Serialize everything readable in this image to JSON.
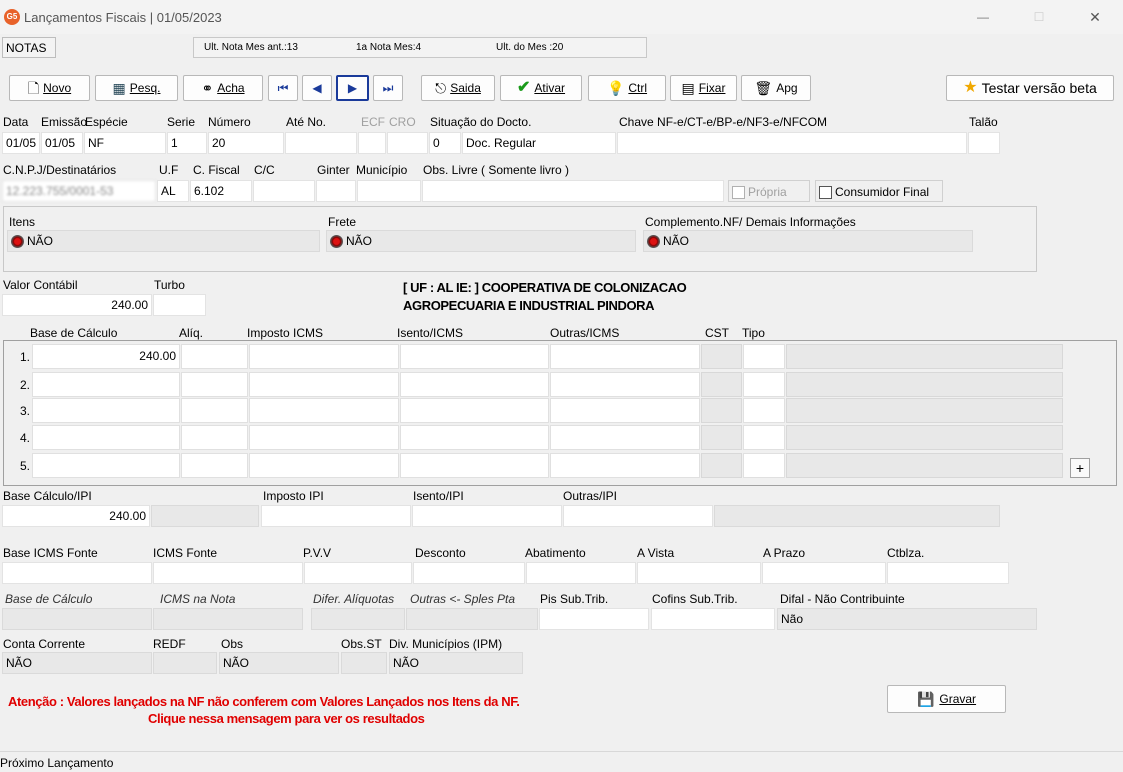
{
  "window": {
    "title": "Lançamentos Fiscais | 01/05/2023",
    "app_icon_text": "G5",
    "min_glyph": "—",
    "max_glyph": "☐",
    "close_glyph": "✕"
  },
  "info_bar": {
    "tab_label": "NOTAS",
    "ult_nota_mes_ant": "Ult. Nota Mes ant.:13",
    "primeira_nota_mes": "1a Nota Mes:4",
    "ult_do_mes": "Ult. do Mes :20"
  },
  "toolbar": {
    "novo": "Novo",
    "pesq": "Pesq.",
    "acha": "Acha",
    "first_glyph": "⏮",
    "prev_glyph": "◀",
    "next_glyph": "▶",
    "last_glyph": "⏭",
    "saida": "Saida",
    "ativar": "Ativar",
    "ctrl": "Ctrl",
    "fixar": "Fixar",
    "apg": "Apg",
    "testar": "Testar versão beta"
  },
  "row1": {
    "labels": {
      "data": "Data",
      "emissao": "Emissão",
      "especie": "Espécie",
      "serie": "Serie",
      "numero": "Número",
      "ate_no": "Até No.",
      "ecf": "ECF",
      "cro": "CRO",
      "situacao": "Situação do Docto.",
      "chave": "Chave NF-e/CT-e/BP-e/NF3-e/NFCOM",
      "talao": "Talão"
    },
    "values": {
      "data": "01/05",
      "emissao": "01/05",
      "especie": "NF",
      "serie": "1",
      "numero": "20",
      "situacao_code": "0",
      "situacao_text": "Doc. Regular"
    }
  },
  "row2": {
    "labels": {
      "cnpj": "C.N.P.J/Destinatários",
      "uf": "U.F",
      "cfiscal": "C. Fiscal",
      "cc": "C/C",
      "ginter": "Ginter",
      "municipio": "Município",
      "obs_livre": "Obs. Livre ( Somente livro )"
    },
    "values": {
      "cnpj": "12.223.755/0001-53",
      "uf": "AL",
      "cfiscal": "6.102"
    },
    "propria": "Própria",
    "consumidor_final": "Consumidor Final"
  },
  "group": {
    "itens_label": "Itens",
    "itens_value": "NÃO",
    "frete_label": "Frete",
    "frete_value": "NÃO",
    "complemento_label": "Complemento.NF/ Demais Informações",
    "complemento_value": "NÃO"
  },
  "valor": {
    "valor_contabil_label": "Valor Contábil",
    "valor_contabil": "240.00",
    "turbo_label": "Turbo",
    "company_line1": "[ UF : AL IE:  ] COOPERATIVA DE COLONIZACAO",
    "company_line2": "AGROPECUARIA E INDUSTRIAL PINDORA"
  },
  "icms_grid": {
    "headers": {
      "base": "Base de Cálculo",
      "aliq": "Alíq.",
      "imposto": "Imposto ICMS",
      "isento": "Isento/ICMS",
      "outras": "Outras/ICMS",
      "cst": "CST",
      "tipo": "Tipo"
    },
    "rows": [
      {
        "n": "1.",
        "base": "240.00"
      },
      {
        "n": "2.",
        "base": ""
      },
      {
        "n": "3.",
        "base": ""
      },
      {
        "n": "4.",
        "base": ""
      },
      {
        "n": "5.",
        "base": ""
      }
    ],
    "add_glyph": "+"
  },
  "ipi": {
    "base_label": "Base Cálculo/IPI",
    "base_value": "240.00",
    "imposto_label": "Imposto IPI",
    "isento_label": "Isento/IPI",
    "outras_label": "Outras/IPI"
  },
  "fonte": {
    "base_icms_fonte": "Base ICMS Fonte",
    "icms_fonte": "ICMS Fonte",
    "pvv": "P.V.V",
    "desconto": "Desconto",
    "abatimento": "Abatimento",
    "a_vista": "A Vista",
    "a_prazo": "A Prazo",
    "ctblza": "Ctblza."
  },
  "italic_row": {
    "base_calculo": "Base de Cálculo",
    "icms_nota": "ICMS na Nota",
    "difer_aliquotas": "Difer. Alíquotas",
    "outras_spl": "Outras <- Sples Pta",
    "pis_sub": "Pis Sub.Trib.",
    "cofins_sub": "Cofins Sub.Trib.",
    "difal_label": "Difal - Não Contribuinte",
    "difal_value": "Não"
  },
  "bottom": {
    "conta_corrente_label": "Conta Corrente",
    "conta_corrente_value": "NÃO",
    "redf_label": "REDF",
    "obs_label": "Obs",
    "obs_value": "NÃO",
    "obs_st_label": "Obs.ST",
    "div_municipios_label": "Div. Municípios (IPM)",
    "div_municipios_value": "NÃO"
  },
  "warning": {
    "line1": "Atenção : Valores lançados na NF não conferem com Valores Lançados nos Itens da NF.",
    "line2": "Clique nessa mensagem para ver os resultados",
    "color": "#e00000"
  },
  "gravar": "Gravar",
  "status": "Próximo  Lançamento"
}
